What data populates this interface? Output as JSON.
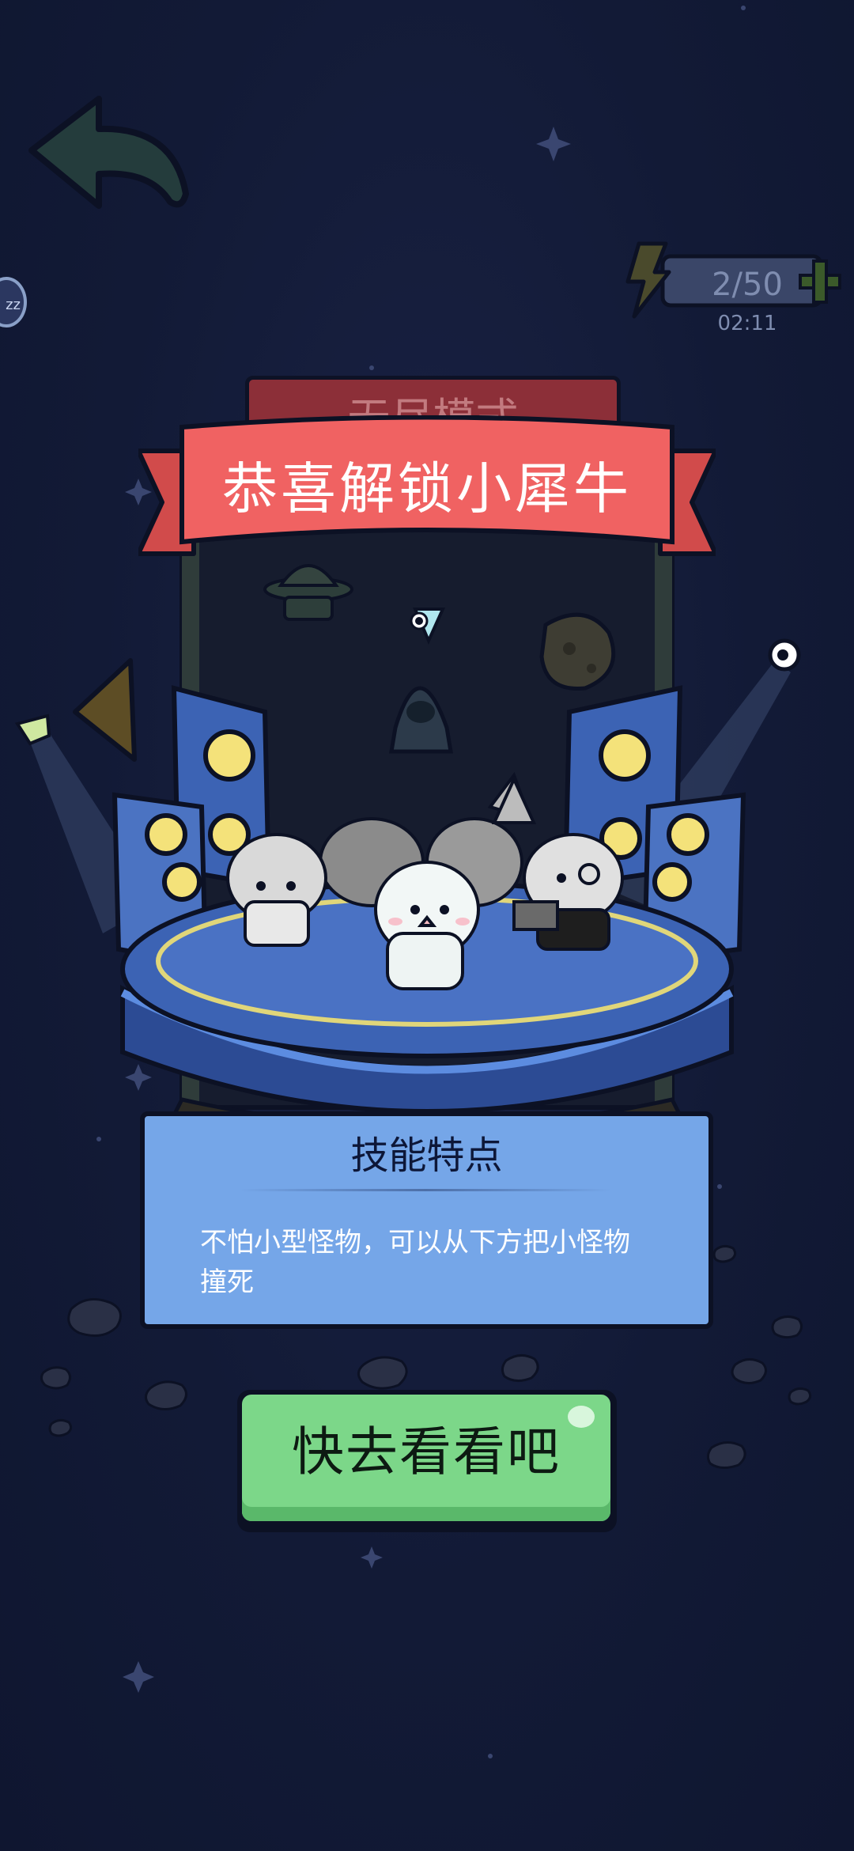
{
  "energy": {
    "value": "2/50",
    "timer": "02:11",
    "bolt_icon": "lightning-bolt-icon",
    "add_icon": "plus-icon"
  },
  "header": {
    "back_icon": "back-arrow-icon",
    "side_badge": "zz"
  },
  "background_tab": {
    "label": "无尽模式"
  },
  "banner": {
    "title": "恭喜解锁小犀牛"
  },
  "skill": {
    "title": "技能特点",
    "description": "不怕小型怪物，可以从下方把小怪物撞死"
  },
  "action": {
    "button_label": "快去看看吧"
  },
  "colors": {
    "background": "#121a36",
    "banner_red": "#f06262",
    "panel_blue": "#75a6e8",
    "button_green": "#7cd789",
    "stage_blue": "#3c63b4",
    "speaker_yellow": "#f4e27a"
  }
}
